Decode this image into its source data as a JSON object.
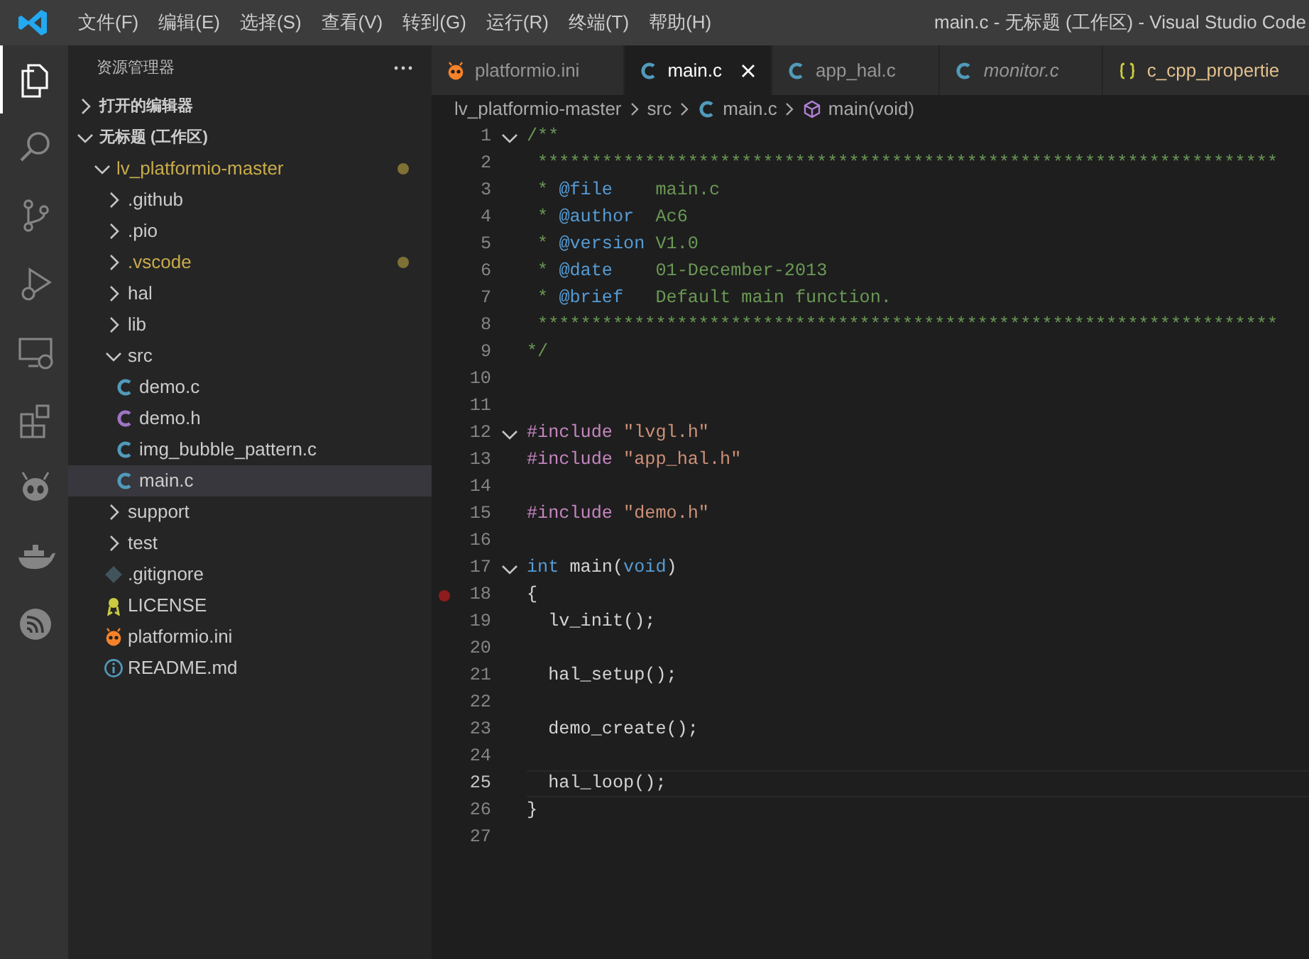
{
  "window": {
    "title": "main.c - 无标题 (工作区) - Visual Studio Code"
  },
  "menu": [
    "文件(F)",
    "编辑(E)",
    "选择(S)",
    "查看(V)",
    "转到(G)",
    "运行(R)",
    "终端(T)",
    "帮助(H)"
  ],
  "activity_bar": [
    {
      "kind": "explorer",
      "selected": true
    },
    {
      "kind": "search",
      "selected": false
    },
    {
      "kind": "source-control",
      "selected": false
    },
    {
      "kind": "debug",
      "selected": false
    },
    {
      "kind": "remote",
      "selected": false
    },
    {
      "kind": "extensions",
      "selected": false
    },
    {
      "kind": "platformio",
      "selected": false
    },
    {
      "kind": "docker",
      "selected": false
    },
    {
      "kind": "espressif",
      "selected": false
    }
  ],
  "explorer": {
    "title": "资源管理器",
    "sections": [
      {
        "label": "打开的编辑器",
        "expanded": false
      },
      {
        "label": "无标题 (工作区)",
        "expanded": true,
        "items": [
          {
            "label": "lv_platformio-master",
            "kind": "folder",
            "expanded": true,
            "modified": true,
            "selected": false,
            "children": [
              {
                "label": ".github",
                "kind": "folder",
                "expanded": false,
                "modified": false,
                "selected": false
              },
              {
                "label": ".pio",
                "kind": "folder",
                "expanded": false,
                "modified": false,
                "selected": false
              },
              {
                "label": ".vscode",
                "kind": "folder",
                "expanded": false,
                "modified": true,
                "selected": false
              },
              {
                "label": "hal",
                "kind": "folder",
                "expanded": false,
                "modified": false,
                "selected": false
              },
              {
                "label": "lib",
                "kind": "folder",
                "expanded": false,
                "modified": false,
                "selected": false
              },
              {
                "label": "src",
                "kind": "folder",
                "expanded": true,
                "modified": false,
                "selected": false,
                "children": [
                  {
                    "label": "demo.c",
                    "kind": "c",
                    "modified": false,
                    "selected": false
                  },
                  {
                    "label": "demo.h",
                    "kind": "h",
                    "modified": false,
                    "selected": false
                  },
                  {
                    "label": "img_bubble_pattern.c",
                    "kind": "c",
                    "modified": false,
                    "selected": false
                  },
                  {
                    "label": "main.c",
                    "kind": "c",
                    "modified": false,
                    "selected": true
                  }
                ]
              },
              {
                "label": "support",
                "kind": "folder",
                "expanded": false,
                "modified": false,
                "selected": false
              },
              {
                "label": "test",
                "kind": "folder",
                "expanded": false,
                "modified": false,
                "selected": false
              },
              {
                "label": ".gitignore",
                "kind": "git",
                "modified": false,
                "selected": false
              },
              {
                "label": "LICENSE",
                "kind": "license",
                "modified": false,
                "selected": false
              },
              {
                "label": "platformio.ini",
                "kind": "pio",
                "modified": false,
                "selected": false
              },
              {
                "label": "README.md",
                "kind": "info",
                "modified": false,
                "selected": false
              }
            ]
          }
        ]
      }
    ]
  },
  "tabs": [
    {
      "label": "platformio.ini",
      "kind": "pio",
      "selected": false,
      "preview": false
    },
    {
      "label": "main.c",
      "kind": "c",
      "selected": true,
      "preview": false
    },
    {
      "label": "app_hal.c",
      "kind": "c",
      "selected": false,
      "preview": false
    },
    {
      "label": "monitor.c",
      "kind": "c",
      "selected": false,
      "preview": true
    },
    {
      "label": "c_cpp_propertie",
      "kind": "json",
      "selected": false,
      "preview": false
    }
  ],
  "breadcrumb": [
    {
      "label": "lv_platformio-master",
      "kind": "folder"
    },
    {
      "label": "src",
      "kind": "folder"
    },
    {
      "label": "main.c",
      "kind": "c"
    },
    {
      "label": "main(void)",
      "kind": "function"
    }
  ],
  "code_lines": [
    {
      "number": "1",
      "foldable": true,
      "breakpoint": false,
      "current": false,
      "segments": [
        {
          "kind": "comment",
          "text": "/**"
        }
      ]
    },
    {
      "number": "2",
      "foldable": false,
      "breakpoint": false,
      "current": false,
      "segments": [
        {
          "kind": "comment",
          "text": " *********************************************************************"
        }
      ]
    },
    {
      "number": "3",
      "foldable": false,
      "breakpoint": false,
      "current": false,
      "segments": [
        {
          "kind": "comment",
          "text": " * "
        },
        {
          "kind": "doctag",
          "text": "@file"
        },
        {
          "kind": "comment",
          "text": "    main.c"
        }
      ]
    },
    {
      "number": "4",
      "foldable": false,
      "breakpoint": false,
      "current": false,
      "segments": [
        {
          "kind": "comment",
          "text": " * "
        },
        {
          "kind": "doctag",
          "text": "@author"
        },
        {
          "kind": "comment",
          "text": "  Ac6"
        }
      ]
    },
    {
      "number": "5",
      "foldable": false,
      "breakpoint": false,
      "current": false,
      "segments": [
        {
          "kind": "comment",
          "text": " * "
        },
        {
          "kind": "doctag",
          "text": "@version"
        },
        {
          "kind": "comment",
          "text": " V1.0"
        }
      ]
    },
    {
      "number": "6",
      "foldable": false,
      "breakpoint": false,
      "current": false,
      "segments": [
        {
          "kind": "comment",
          "text": " * "
        },
        {
          "kind": "doctag",
          "text": "@date"
        },
        {
          "kind": "comment",
          "text": "    01-December-2013"
        }
      ]
    },
    {
      "number": "7",
      "foldable": false,
      "breakpoint": false,
      "current": false,
      "segments": [
        {
          "kind": "comment",
          "text": " * "
        },
        {
          "kind": "doctag",
          "text": "@brief"
        },
        {
          "kind": "comment",
          "text": "   Default main function."
        }
      ]
    },
    {
      "number": "8",
      "foldable": false,
      "breakpoint": false,
      "current": false,
      "segments": [
        {
          "kind": "comment",
          "text": " *********************************************************************"
        }
      ]
    },
    {
      "number": "9",
      "foldable": false,
      "breakpoint": false,
      "current": false,
      "segments": [
        {
          "kind": "comment",
          "text": "*/"
        }
      ]
    },
    {
      "number": "10",
      "foldable": false,
      "breakpoint": false,
      "current": false
    },
    {
      "number": "11",
      "foldable": false,
      "breakpoint": false,
      "current": false
    },
    {
      "number": "12",
      "foldable": true,
      "breakpoint": false,
      "current": false,
      "segments": [
        {
          "kind": "directive",
          "text": "#include"
        },
        {
          "kind": "string",
          "text": " \"lvgl.h\""
        }
      ]
    },
    {
      "number": "13",
      "foldable": false,
      "breakpoint": false,
      "current": false,
      "segments": [
        {
          "kind": "directive",
          "text": "#include"
        },
        {
          "kind": "string",
          "text": " \"app_hal.h\""
        }
      ]
    },
    {
      "number": "14",
      "foldable": false,
      "breakpoint": false,
      "current": false
    },
    {
      "number": "15",
      "foldable": false,
      "breakpoint": false,
      "current": false,
      "segments": [
        {
          "kind": "directive",
          "text": "#include"
        },
        {
          "kind": "string",
          "text": " \"demo.h\""
        }
      ]
    },
    {
      "number": "16",
      "foldable": false,
      "breakpoint": false,
      "current": false
    },
    {
      "number": "17",
      "foldable": true,
      "breakpoint": false,
      "current": false,
      "segments": [
        {
          "kind": "keyword",
          "text": "int"
        },
        {
          "kind": "plain",
          "text": " main("
        },
        {
          "kind": "keyword",
          "text": "void"
        },
        {
          "kind": "plain",
          "text": ")"
        }
      ]
    },
    {
      "number": "18",
      "foldable": false,
      "breakpoint": true,
      "current": false,
      "segments": [
        {
          "kind": "plain",
          "text": "{"
        }
      ]
    },
    {
      "number": "19",
      "foldable": false,
      "breakpoint": false,
      "current": false,
      "segments": [
        {
          "kind": "plain",
          "text": "  lv_init();"
        }
      ]
    },
    {
      "number": "20",
      "foldable": false,
      "breakpoint": false,
      "current": false
    },
    {
      "number": "21",
      "foldable": false,
      "breakpoint": false,
      "current": false,
      "segments": [
        {
          "kind": "plain",
          "text": "  hal_setup();"
        }
      ]
    },
    {
      "number": "22",
      "foldable": false,
      "breakpoint": false,
      "current": false
    },
    {
      "number": "23",
      "foldable": false,
      "breakpoint": false,
      "current": false,
      "segments": [
        {
          "kind": "plain",
          "text": "  demo_create();"
        }
      ]
    },
    {
      "number": "24",
      "foldable": false,
      "breakpoint": false,
      "current": false
    },
    {
      "number": "25",
      "foldable": false,
      "breakpoint": false,
      "current": true,
      "segments": [
        {
          "kind": "plain",
          "text": "  hal_loop();"
        }
      ]
    },
    {
      "number": "26",
      "foldable": false,
      "breakpoint": false,
      "current": false,
      "segments": [
        {
          "kind": "plain",
          "text": "}"
        }
      ]
    },
    {
      "number": "27",
      "foldable": false,
      "breakpoint": false,
      "current": false
    }
  ]
}
